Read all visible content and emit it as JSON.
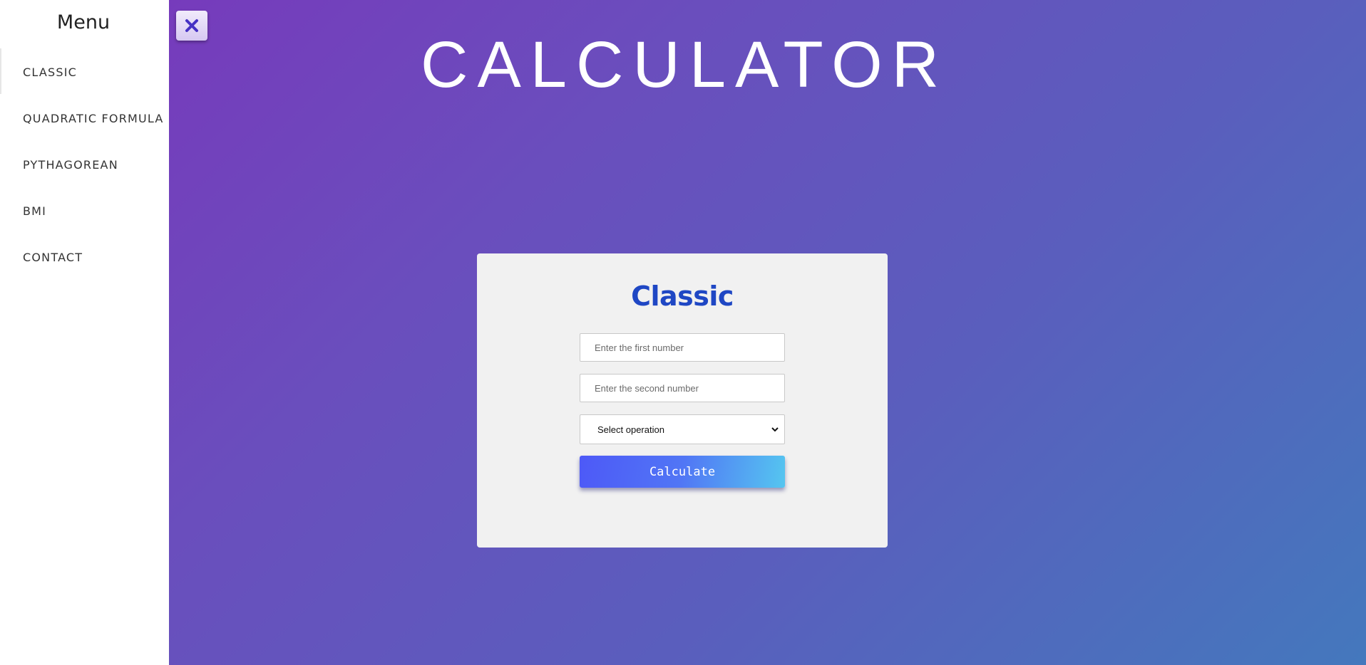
{
  "sidebar": {
    "title": "Menu",
    "items": [
      {
        "label": "CLASSIC"
      },
      {
        "label": "QUADRATIC FORMULA"
      },
      {
        "label": "PYTHAGOREAN"
      },
      {
        "label": "BMI"
      },
      {
        "label": "CONTACT"
      }
    ]
  },
  "header": {
    "title": "CALCULATOR",
    "close_icon": "close-icon"
  },
  "card": {
    "title": "Classic",
    "first_number_placeholder": "Enter the first number",
    "second_number_placeholder": "Enter the second number",
    "operation_selected": "Select operation",
    "calculate_label": "Calculate"
  },
  "colors": {
    "background_start": "#7a35bb",
    "background_end": "#4478bd",
    "card_title": "#1f47c4",
    "button_start": "#4d59f7",
    "button_end": "#55c6f0",
    "close_icon": "#4631c4"
  }
}
